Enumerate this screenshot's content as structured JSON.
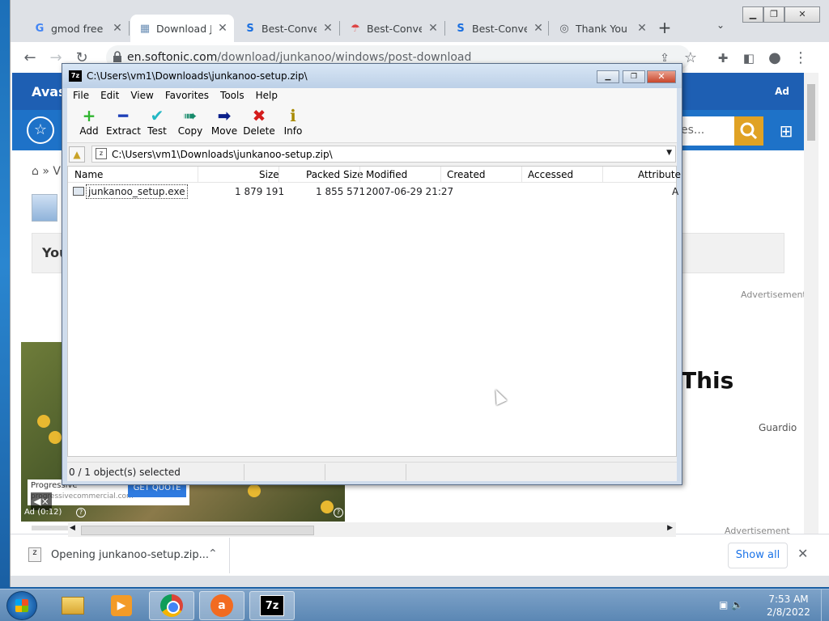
{
  "chrome": {
    "tabs": [
      {
        "title": "gmod free c",
        "favicon": "G"
      },
      {
        "title": "Download J",
        "favicon": "▦"
      },
      {
        "title": "Best-Conver",
        "favicon": "S"
      },
      {
        "title": "Best-Conver",
        "favicon": "☂"
      },
      {
        "title": "Best-Conver",
        "favicon": "S"
      },
      {
        "title": "Thank You",
        "favicon": "◎"
      }
    ],
    "new_tab": "+",
    "tab_menu": "⌄",
    "url_host": "en.softonic.com",
    "url_path": "/download/junkanoo/windows/post-download"
  },
  "page": {
    "avast_text": "Avast",
    "ad_label": "Ad",
    "search_placeholder": "es...",
    "gray_banner_text": "You",
    "advertisement": "Advertisement",
    "big_text": "This",
    "guardio": "Guardio",
    "breadcrumb": "» V"
  },
  "video_ad": {
    "brand": "Progressive",
    "domain": "progressivecommercial.com",
    "cta": "GET QUOTE",
    "timer": "Ad (0:12)",
    "mute": "◀×"
  },
  "download_bar": {
    "item_name": "Opening junkanoo-setup.zip...",
    "show_all": "Show all"
  },
  "zip": {
    "title": "C:\\Users\\vm1\\Downloads\\junkanoo-setup.zip\\",
    "menu": [
      "File",
      "Edit",
      "View",
      "Favorites",
      "Tools",
      "Help"
    ],
    "toolbar": [
      {
        "label": "Add",
        "icon": "plus-icon",
        "glyph": "+",
        "color": "#2fb52f"
      },
      {
        "label": "Extract",
        "icon": "minus-icon",
        "glyph": "━",
        "color": "#1d3fb8"
      },
      {
        "label": "Test",
        "icon": "check-icon",
        "glyph": "✔",
        "color": "#23b8c4"
      },
      {
        "label": "Copy",
        "icon": "double-arrow-icon",
        "glyph": "➠",
        "color": "#168a6a"
      },
      {
        "label": "Move",
        "icon": "arrow-right-icon",
        "glyph": "➡",
        "color": "#0a1f8a"
      },
      {
        "label": "Delete",
        "icon": "x-icon",
        "glyph": "✖",
        "color": "#d41c1c"
      },
      {
        "label": "Info",
        "icon": "info-icon",
        "glyph": "ℹ",
        "color": "#a88a00"
      }
    ],
    "address": "C:\\Users\\vm1\\Downloads\\junkanoo-setup.zip\\",
    "columns": [
      "Name",
      "Size",
      "Packed Size",
      "Modified",
      "Created",
      "Accessed",
      "Attribute"
    ],
    "files": [
      {
        "name": "junkanoo_setup.exe",
        "size": "1 879 191",
        "packed": "1 855 571",
        "modified": "2007-06-29 21:27",
        "created": "",
        "accessed": "",
        "attr": "A"
      }
    ],
    "status": "0 / 1 object(s) selected"
  },
  "taskbar": {
    "apps": [
      "explorer",
      "media-player",
      "chrome",
      "avast",
      "7-zip"
    ],
    "time": "7:53 AM",
    "date": "2/8/2022"
  },
  "colors": {
    "chrome_frame": "#dee1e6",
    "softonic_blue": "#1e72c8",
    "zip_frame": "#cfdcec",
    "accent_link": "#1a73e8"
  }
}
